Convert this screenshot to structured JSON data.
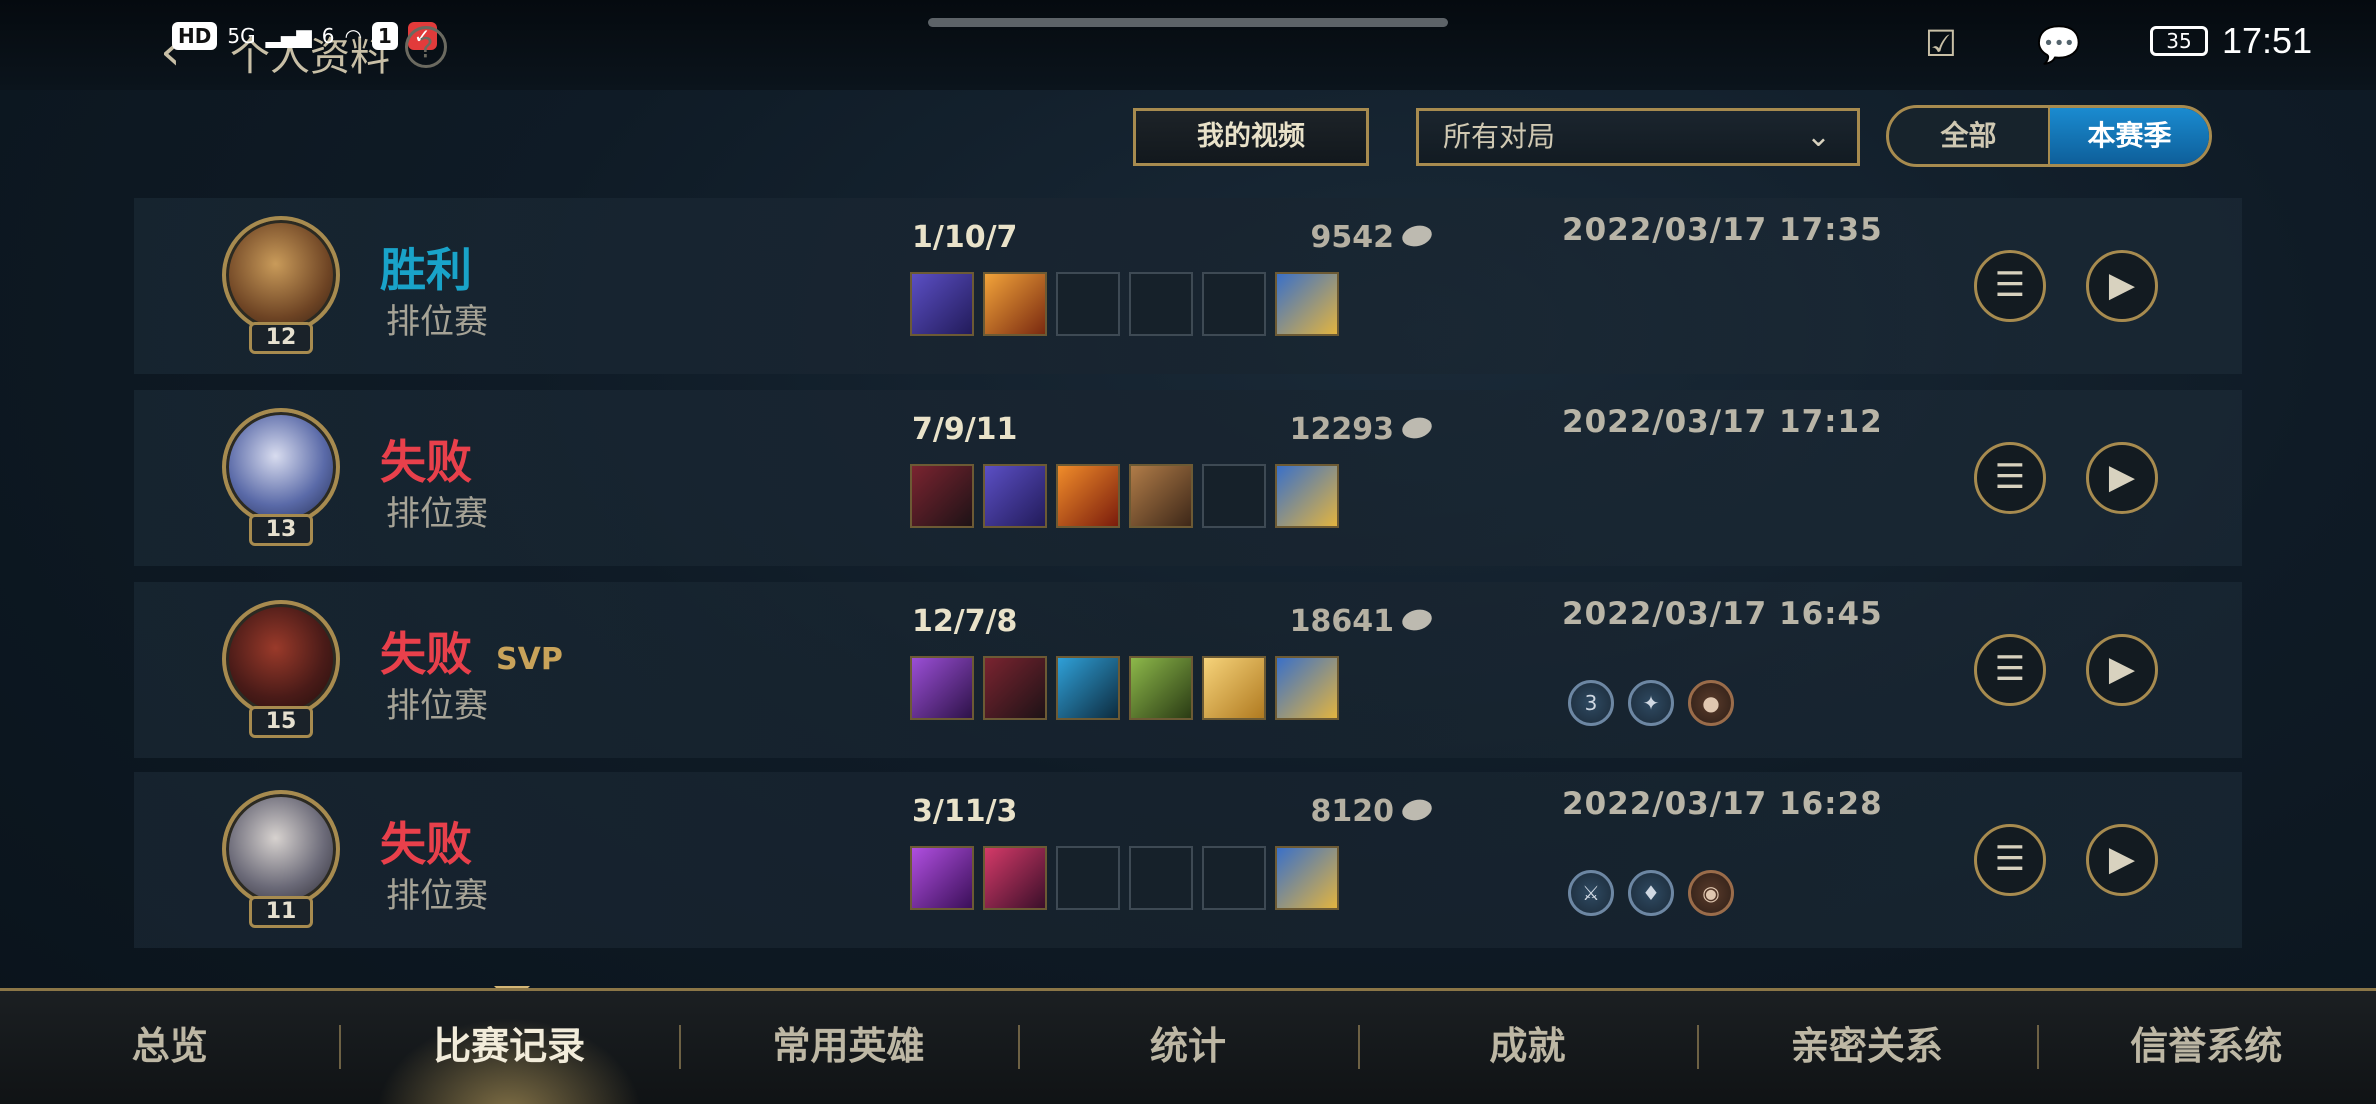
{
  "status_bar": {
    "left_icons": [
      "HD",
      "5G",
      "6",
      "signal-icon",
      "wifi-icon",
      "1",
      "notification-icon"
    ],
    "title": "个人资料",
    "battery": "35",
    "time": "17:51"
  },
  "filters": {
    "video_button": "我的视频",
    "match_filter": "所有对局",
    "season_toggle": [
      "全部",
      "本赛季"
    ],
    "season_selected": "本赛季"
  },
  "matches": [
    {
      "result": "胜利",
      "result_type": "win",
      "svp": "",
      "mode": "排位赛",
      "level": "12",
      "kda": "1/10/7",
      "gold": "9542",
      "date": "2022/03/17 17:35",
      "items": [
        "purple-dagger",
        "sun-staff",
        "empty",
        "empty",
        "empty",
        "trinket"
      ],
      "badges": []
    },
    {
      "result": "失败",
      "result_type": "loss",
      "svp": "",
      "mode": "排位赛",
      "level": "13",
      "kda": "7/9/11",
      "gold": "12293",
      "date": "2022/03/17 17:12",
      "items": [
        "dark-blade",
        "purple-dagger",
        "fire-spear",
        "hammer",
        "empty",
        "trinket"
      ],
      "badges": []
    },
    {
      "result": "失败",
      "result_type": "loss",
      "svp": "SVP",
      "mode": "排位赛",
      "level": "15",
      "kda": "12/7/8",
      "gold": "18641",
      "date": "2022/03/17 16:45",
      "items": [
        "violet-sword",
        "dark-blade",
        "blue-spear",
        "green-axe",
        "angel-wings",
        "trinket"
      ],
      "badges": [
        {
          "label": "3",
          "style": "silver"
        },
        {
          "label": "✦",
          "style": "silver"
        },
        {
          "label": "●",
          "style": "bronze"
        }
      ]
    },
    {
      "result": "失败",
      "result_type": "loss",
      "svp": "",
      "mode": "排位赛",
      "level": "11",
      "kda": "3/11/3",
      "gold": "8120",
      "date": "2022/03/17 16:28",
      "items": [
        "violet-blade",
        "red-claw",
        "empty",
        "empty",
        "empty",
        "trinket"
      ],
      "badges": [
        {
          "label": "⚔",
          "style": "silver"
        },
        {
          "label": "♦",
          "style": "silver"
        },
        {
          "label": "◉",
          "style": "bronze"
        }
      ]
    }
  ],
  "nav": {
    "items": [
      "总览",
      "比赛记录",
      "常用英雄",
      "统计",
      "成就",
      "亲密关系",
      "信誉系统"
    ],
    "active": "比赛记录"
  },
  "colors": {
    "win": "#19a3c9",
    "loss": "#e8404b",
    "gold_accent": "#a78b4f",
    "active_segment": "#1a8bd0"
  }
}
